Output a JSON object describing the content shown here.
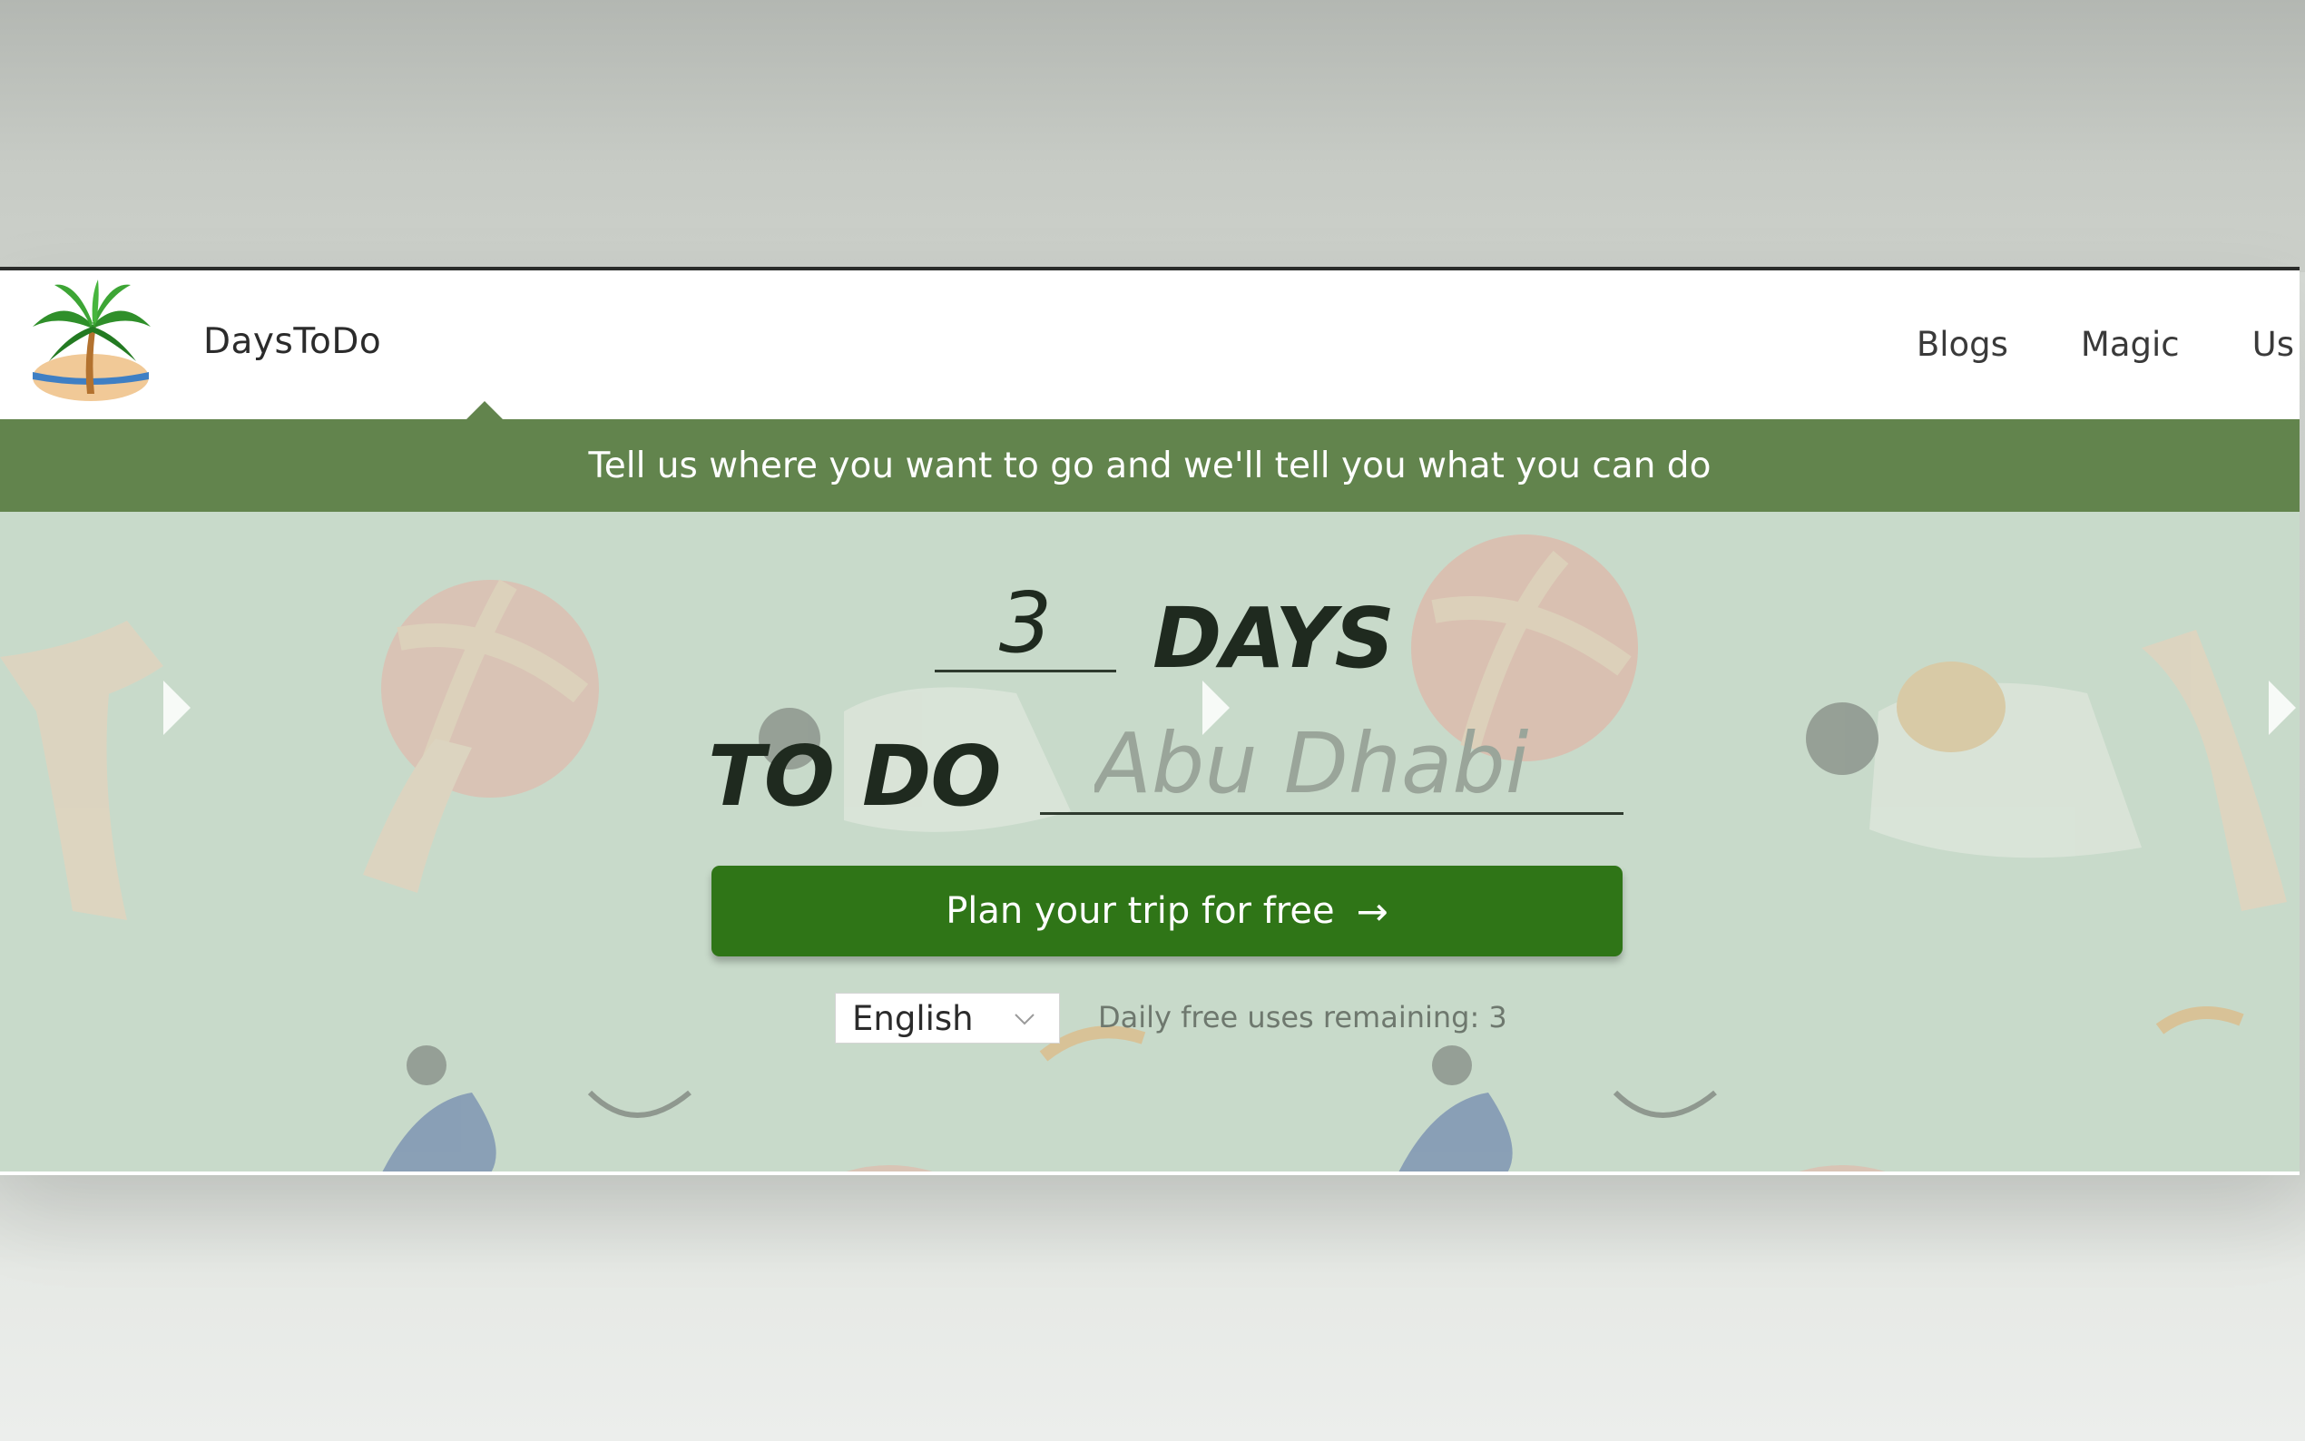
{
  "brand": {
    "name": "DaysToDo",
    "logo_icon": "palm-tree-beach-icon"
  },
  "nav": {
    "items": [
      "Blogs",
      "Magic",
      "Us"
    ]
  },
  "banner": {
    "text": "Tell us where you want to go and we'll tell you what you can do"
  },
  "hero": {
    "days_value": "3",
    "days_label": "DAYS",
    "todo_label": "TO DO",
    "destination_placeholder": "Abu Dhabi",
    "plan_button_label": "Plan your trip for free",
    "plan_button_icon": "arrow-right-icon",
    "slider_icon": "slider-next-icon"
  },
  "language": {
    "selected": "English",
    "icon": "chevron-down-icon"
  },
  "usage": {
    "text": "Daily free uses remaining: 3"
  },
  "colors": {
    "brand_green": "#62844d",
    "button_green": "#2f7517",
    "hero_background": "#c7d8c9",
    "text_dark": "#1f2a1f"
  }
}
